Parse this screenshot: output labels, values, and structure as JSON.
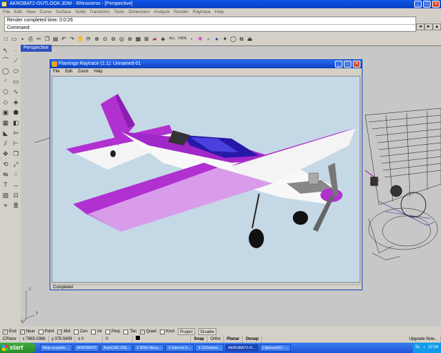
{
  "window": {
    "title": "AKROBAT2-OUTLOOK.3DM - Rhinoceros - [Perspective]",
    "min": "_",
    "max": "□",
    "close": "×"
  },
  "menu": [
    "File",
    "Edit",
    "View",
    "Curve",
    "Surface",
    "Solid",
    "Transform",
    "Tools",
    "Dimension",
    "Analyze",
    "Render",
    "Raytrace",
    "Help"
  ],
  "command": {
    "history": "Render completed time: 0:0:26",
    "prompt": "Command:",
    "scroll_left": "◄",
    "scroll_right": "►",
    "scroll_expand": "▲"
  },
  "toolbar": {
    "all_label": "ALL",
    "hide_label": "HIDE",
    "icons": [
      "new-icon",
      "open-icon",
      "save-icon",
      "print-icon",
      "cut-icon",
      "copy-icon",
      "paste-icon",
      "undo-icon",
      "redo-icon",
      "pan-icon",
      "rotate-icon",
      "zoom-dynamic-icon",
      "zoom-window-icon",
      "zoom-extents-icon",
      "zoom-selected-icon",
      "zoom-all-icon",
      "grid-icon",
      "four-viewports-icon",
      "car-icon",
      "layer-icon",
      "render-icon",
      "shade-icon",
      "material-icon",
      "sphere-icon",
      "ray-icon",
      "circle-icon",
      "plugin-icon"
    ]
  },
  "viewport": {
    "name": "Perspective",
    "axis_x": "x",
    "axis_y": "y",
    "axis_z": "z"
  },
  "flamingo": {
    "title": "Flamingo Raytrace (1:1): Unnamed-01",
    "menu": [
      "File",
      "Edit",
      "Zoom",
      "Help"
    ],
    "status": "Completed",
    "colors": {
      "fuselage": "#f2f2f2",
      "trim": "#a020c8",
      "canopy": "#2818a8",
      "background": "#c4d8e6"
    }
  },
  "osnap": {
    "items": [
      {
        "label": "End",
        "checked": true
      },
      {
        "label": "Near",
        "checked": true
      },
      {
        "label": "Point",
        "checked": false
      },
      {
        "label": "Mid",
        "checked": true
      },
      {
        "label": "Cen",
        "checked": false
      },
      {
        "label": "Int",
        "checked": false
      },
      {
        "label": "Perp",
        "checked": false
      },
      {
        "label": "Tan",
        "checked": false
      },
      {
        "label": "Quad",
        "checked": true
      },
      {
        "label": "Knot",
        "checked": false
      }
    ],
    "project": "Project",
    "disable": "Disable"
  },
  "status": {
    "cplane": "CPlane",
    "x": "x 7865.0368",
    "y": "y 375.5409",
    "z": "z 0",
    "zero": "0",
    "snap": "Snap",
    "ortho": "Ortho",
    "planar": "Planar",
    "osnap": "Osnap",
    "upgrade": "Upgrade Now..."
  },
  "taskbar": {
    "start": "start",
    "items": [
      "Moje projekte ...",
      "AKROBAT2",
      "AutoCAD 200...",
      "2 MSN Mess...",
      "2 Internet E...",
      "3 CDIndexe...",
      "AKROBAT2-O...",
      "Clipboard01 -..."
    ],
    "lang": "SL",
    "time": "22:04"
  }
}
